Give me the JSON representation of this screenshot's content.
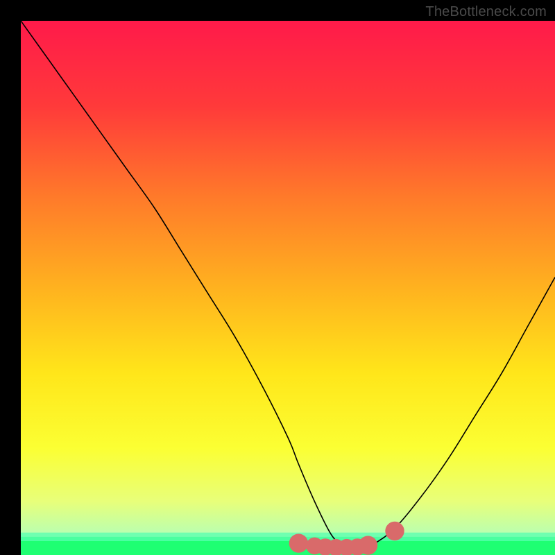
{
  "watermark": "TheBottleneck.com",
  "gradient": {
    "stops": [
      {
        "pos": 0,
        "color": "#ff1a4a"
      },
      {
        "pos": 0.16,
        "color": "#ff3a3a"
      },
      {
        "pos": 0.33,
        "color": "#ff7a2a"
      },
      {
        "pos": 0.5,
        "color": "#ffb21f"
      },
      {
        "pos": 0.66,
        "color": "#ffe61a"
      },
      {
        "pos": 0.8,
        "color": "#fbff33"
      },
      {
        "pos": 0.9,
        "color": "#e8ff7a"
      },
      {
        "pos": 0.96,
        "color": "#baffb0"
      },
      {
        "pos": 1.0,
        "color": "#2eff7a"
      }
    ]
  },
  "green_bands": [
    {
      "top": 0.958,
      "height": 0.008,
      "color": "#6fffb0"
    },
    {
      "top": 0.966,
      "height": 0.008,
      "color": "#4affa0"
    },
    {
      "top": 0.974,
      "height": 0.026,
      "color": "#1eff72"
    }
  ],
  "chart_data": {
    "type": "line",
    "title": "",
    "xlabel": "",
    "ylabel": "",
    "xlim": [
      0,
      100
    ],
    "ylim": [
      0,
      100
    ],
    "series": [
      {
        "name": "bottleneck-curve",
        "x": [
          0,
          5,
          10,
          15,
          20,
          25,
          30,
          35,
          40,
          45,
          50,
          52,
          55,
          58,
          60,
          62,
          64,
          66,
          70,
          75,
          80,
          85,
          90,
          95,
          100
        ],
        "y": [
          100,
          93,
          86,
          79,
          72,
          65,
          57,
          49,
          41,
          32,
          22,
          17,
          10,
          4,
          2,
          1,
          1,
          2,
          5,
          11,
          18,
          26,
          34,
          43,
          52
        ]
      }
    ],
    "markers": [
      {
        "name": "flat-region-left-cap",
        "x": 52,
        "y": 2.2,
        "r": 1.4
      },
      {
        "name": "flat-region-pt1",
        "x": 55,
        "y": 1.7,
        "r": 1.2
      },
      {
        "name": "flat-region-pt2",
        "x": 57,
        "y": 1.5,
        "r": 1.2
      },
      {
        "name": "flat-region-pt3",
        "x": 59,
        "y": 1.4,
        "r": 1.2
      },
      {
        "name": "flat-region-pt4",
        "x": 61,
        "y": 1.4,
        "r": 1.2
      },
      {
        "name": "flat-region-pt5",
        "x": 63,
        "y": 1.5,
        "r": 1.2
      },
      {
        "name": "flat-region-right-cap",
        "x": 65,
        "y": 1.8,
        "r": 1.4
      },
      {
        "name": "outlier-marker",
        "x": 70,
        "y": 4.5,
        "r": 1.4
      }
    ],
    "marker_color": "#d96a6a",
    "curve_color": "#000000"
  }
}
